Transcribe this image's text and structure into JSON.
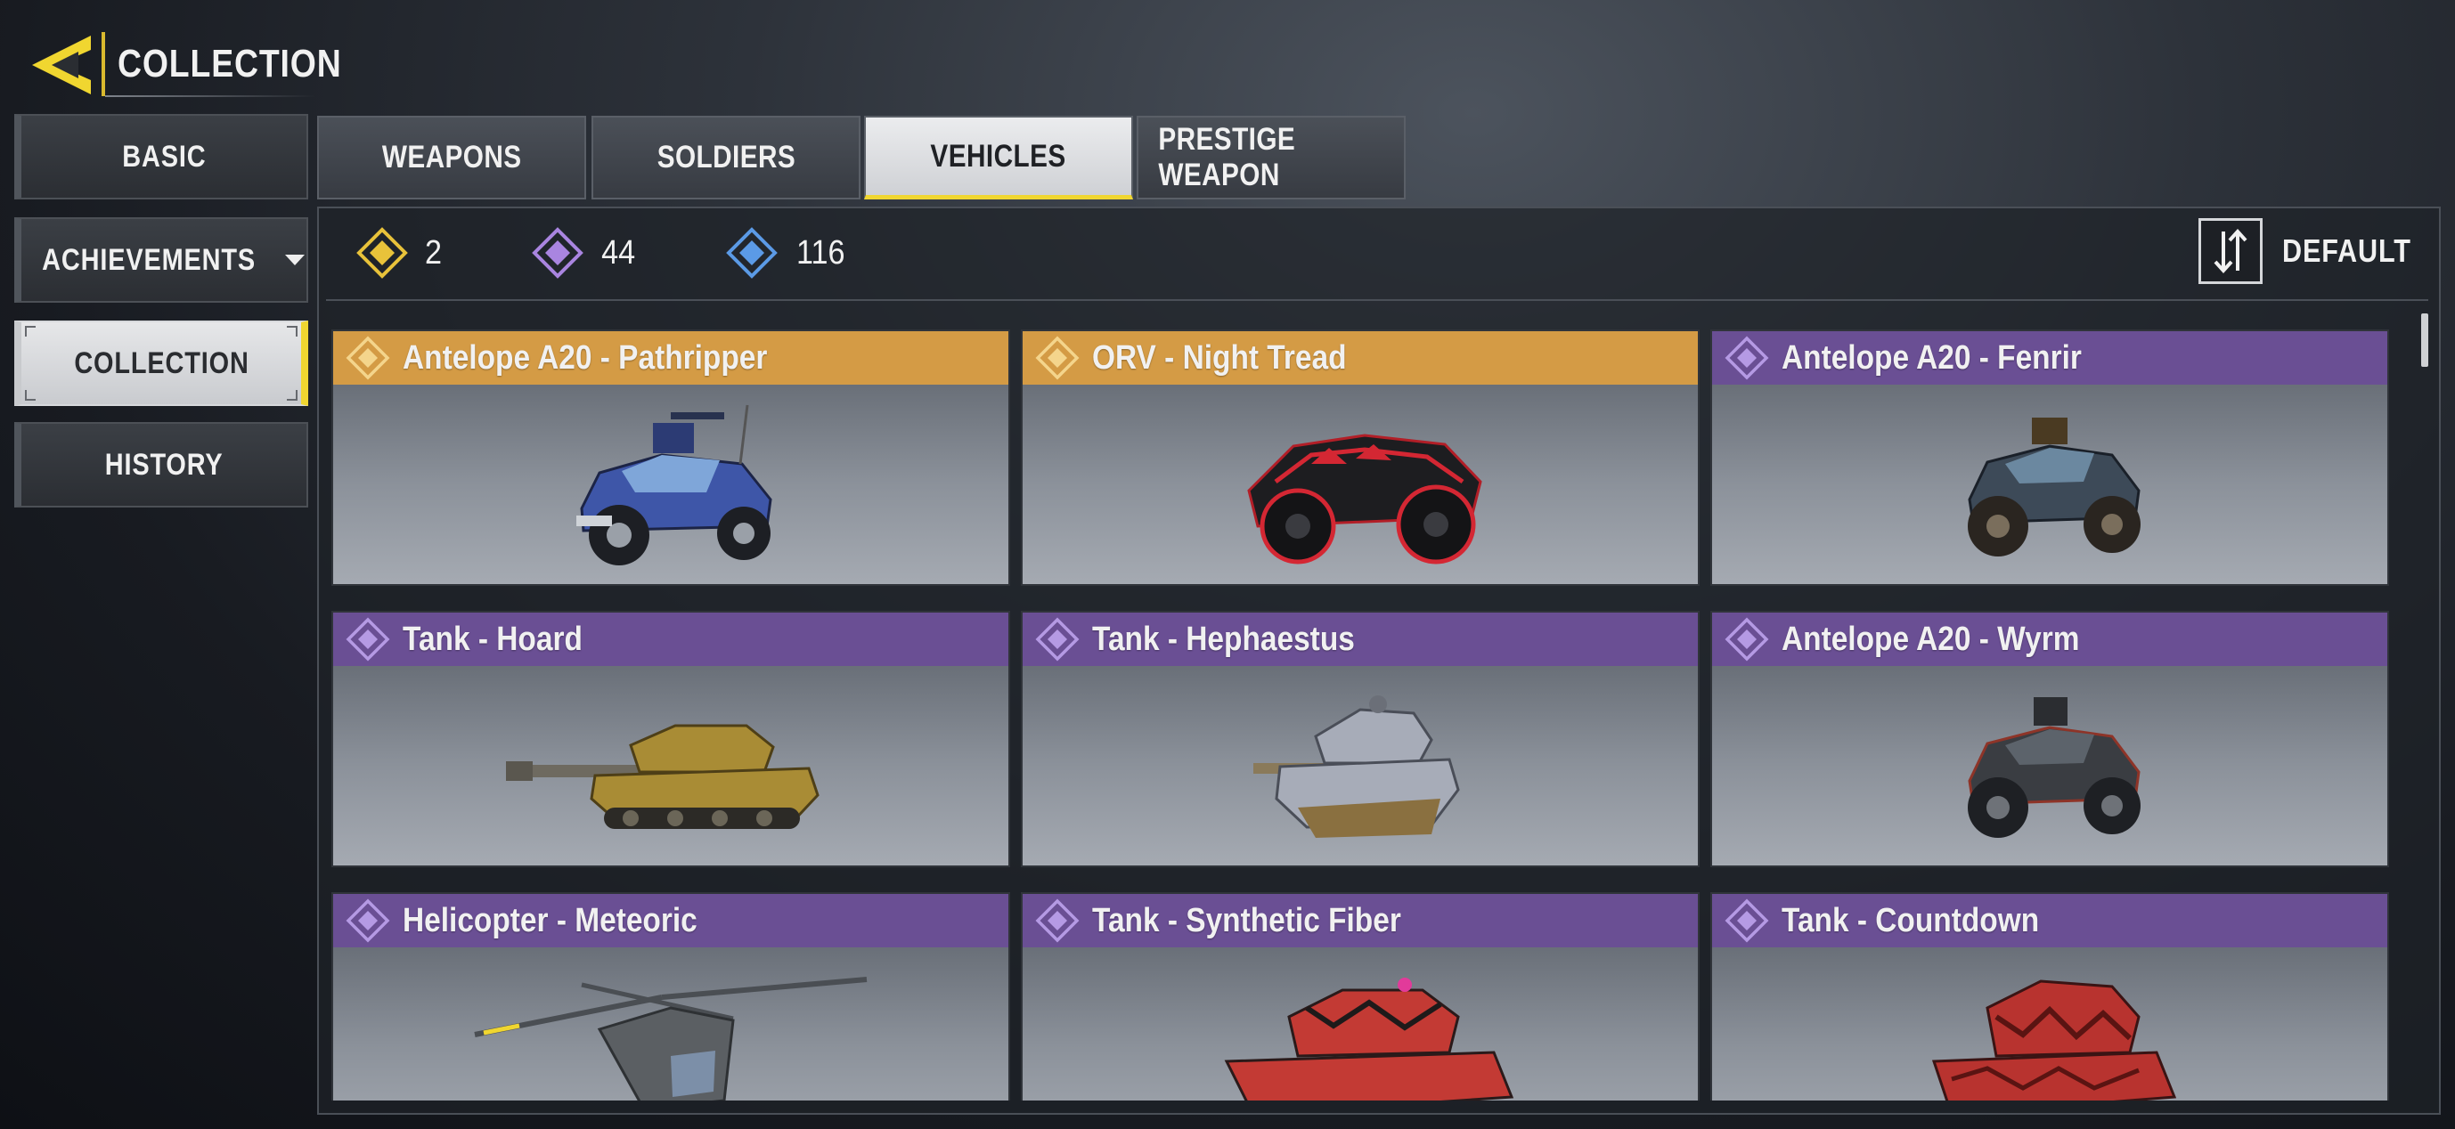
{
  "header": {
    "title": "COLLECTION",
    "back_icon": "back-arrow-icon"
  },
  "nav": {
    "items": [
      {
        "label": "BASIC"
      },
      {
        "label": "ACHIEVEMENTS"
      },
      {
        "label": "COLLECTION"
      },
      {
        "label": "HISTORY"
      }
    ],
    "active": "COLLECTION"
  },
  "tabs": {
    "items": [
      {
        "label": "WEAPONS"
      },
      {
        "label": "SOLDIERS"
      },
      {
        "label": "VEHICLES"
      },
      {
        "label": "PRESTIGE WEAPON"
      }
    ],
    "active": "VEHICLES"
  },
  "stats": [
    {
      "rarity": "legendary",
      "color": "#e8c23a",
      "count": "2"
    },
    {
      "rarity": "epic",
      "color": "#a985e0",
      "count": "44"
    },
    {
      "rarity": "rare",
      "color": "#5b9ae6",
      "count": "116"
    }
  ],
  "sort": {
    "label": "DEFAULT",
    "icon": "sort-arrows-icon"
  },
  "colors": {
    "accent": "#f0d630",
    "legendary": "#d49b45",
    "epic": "#6a4f94"
  },
  "vehicles": [
    {
      "name": "Antelope A20 - Pathripper",
      "rarity": "legendary",
      "kind": "buggy",
      "paint": "#3e56a8"
    },
    {
      "name": "ORV - Night Tread",
      "rarity": "legendary",
      "kind": "orv",
      "paint": "#1d1d20"
    },
    {
      "name": "Antelope A20 - Fenrir",
      "rarity": "epic",
      "kind": "buggy",
      "paint": "#3d4a58"
    },
    {
      "name": "Tank - Hoard",
      "rarity": "epic",
      "kind": "tank",
      "paint": "#a98c35"
    },
    {
      "name": "Tank - Hephaestus",
      "rarity": "epic",
      "kind": "tank",
      "paint": "#a7acb8"
    },
    {
      "name": "Antelope A20 - Wyrm",
      "rarity": "epic",
      "kind": "buggy",
      "paint": "#3a3d42"
    },
    {
      "name": "Helicopter - Meteoric",
      "rarity": "epic",
      "kind": "heli",
      "paint": "#5b5f63"
    },
    {
      "name": "Tank - Synthetic Fiber",
      "rarity": "epic",
      "kind": "tank",
      "paint": "#c33a34"
    },
    {
      "name": "Tank - Countdown",
      "rarity": "epic",
      "kind": "tank",
      "paint": "#b8332f"
    }
  ]
}
